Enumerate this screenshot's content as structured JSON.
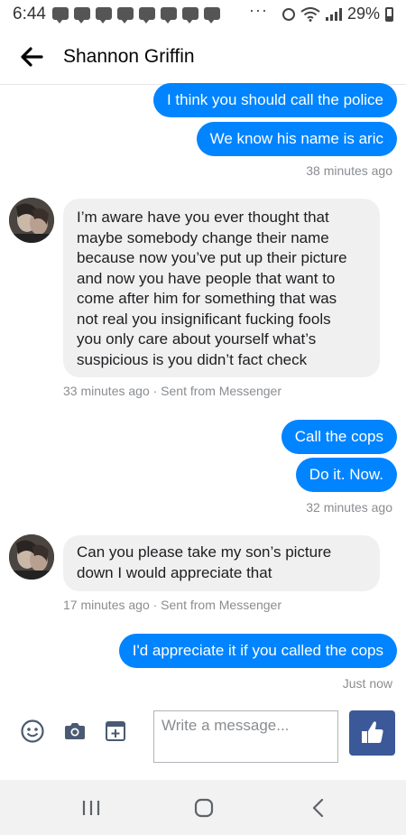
{
  "status_bar": {
    "time": "6:44",
    "more": "···",
    "battery": "29%"
  },
  "header": {
    "title": "Shannon Griffin"
  },
  "messages": [
    {
      "text": "I think you should call the police"
    },
    {
      "text": "We know his name is aric"
    },
    {
      "timestamp": "38 minutes ago"
    },
    {
      "lines": [
        "I’m aware have you ever thought that",
        "maybe somebody change their name",
        "because now you’ve put up their picture",
        "and now you have people that want to",
        "come after him for something that was",
        "not real you insignificant fucking fools",
        "you only care about yourself what’s",
        "suspicious is you didn’t fact check"
      ],
      "meta": "33 minutes ago · Sent from Messenger"
    },
    {
      "text": "Call the cops"
    },
    {
      "text": "Do it. Now."
    },
    {
      "timestamp": "32 minutes ago"
    },
    {
      "lines": [
        "Can you please take my son’s picture",
        "down I would appreciate that"
      ],
      "meta": "17 minutes ago · Sent from Messenger"
    },
    {
      "text": "I'd appreciate it if you called the cops"
    },
    {
      "timestamp": "Just now"
    }
  ],
  "composer": {
    "placeholder": "Write a message..."
  },
  "colors": {
    "outgoing_bubble": "#0084ff",
    "incoming_bubble": "#f1f0f0",
    "like_button": "#3b5998"
  },
  "icons": {
    "back": "arrow-left-icon",
    "emoji": "smiley-icon",
    "camera": "camera-icon",
    "gallery": "add-media-icon",
    "like": "thumbs-up-icon",
    "nav_recents": "recent-apps-icon",
    "nav_home": "home-icon",
    "nav_back": "back-chevron-icon"
  }
}
